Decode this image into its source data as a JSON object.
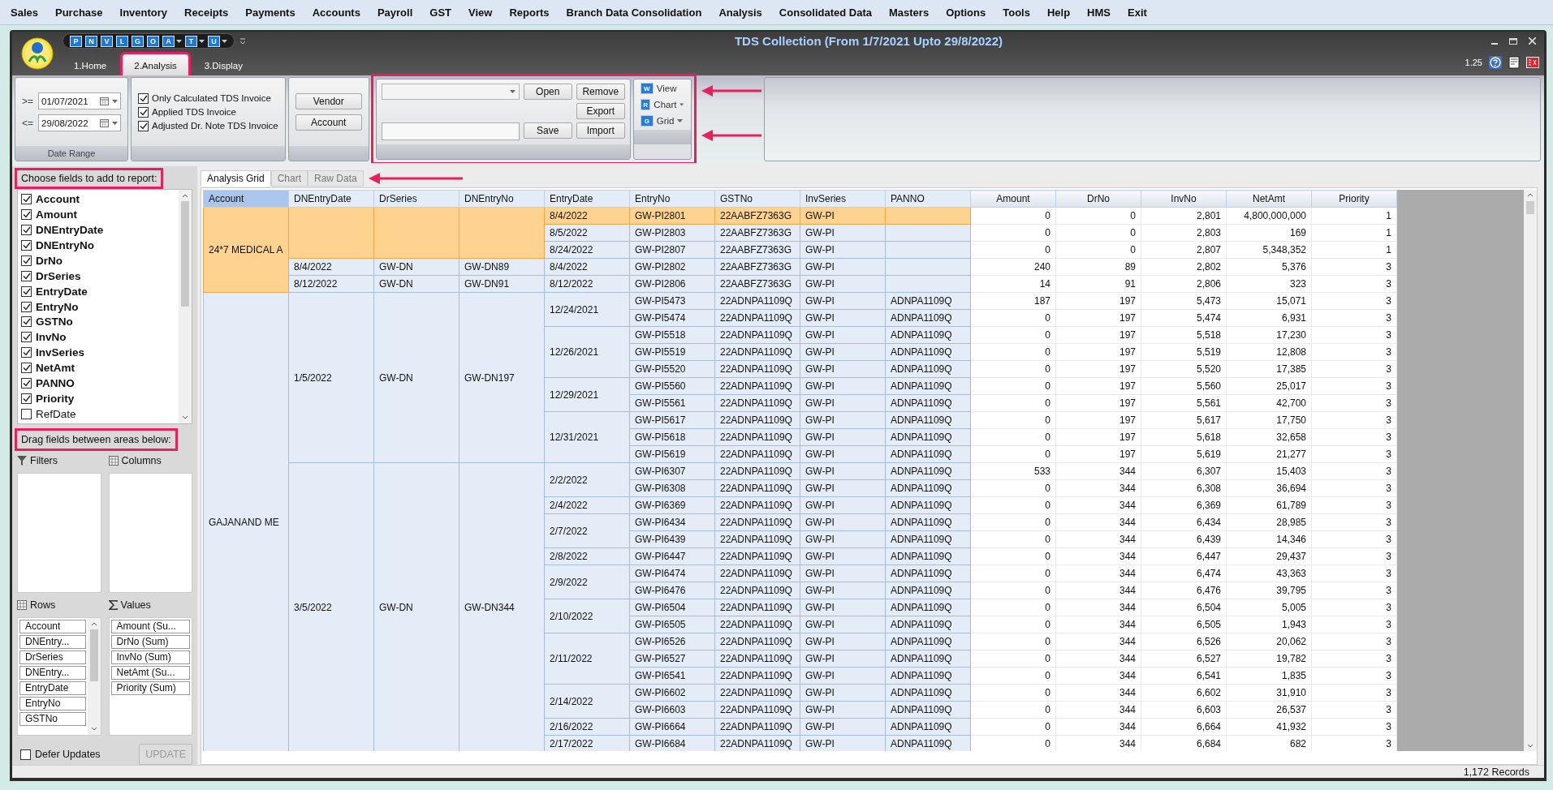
{
  "menu": [
    "Sales",
    "Purchase",
    "Inventory",
    "Receipts",
    "Payments",
    "Accounts",
    "Payroll",
    "GST",
    "View",
    "Reports",
    "Branch Data Consolidation",
    "Analysis",
    "Consolidated Data",
    "Masters",
    "Options",
    "Tools",
    "Help",
    "HMS",
    "Exit"
  ],
  "window": {
    "title": "TDS Collection (From 1/7/2021 Upto 29/8/2022)",
    "zoom": "1.25",
    "quick_access": [
      {
        "letter": "P",
        "dropdown": false
      },
      {
        "letter": "N",
        "dropdown": false
      },
      {
        "letter": "V",
        "dropdown": false
      },
      {
        "letter": "L",
        "dropdown": false
      },
      {
        "letter": "G",
        "dropdown": false
      },
      {
        "letter": "O",
        "dropdown": false
      },
      {
        "letter": "A",
        "dropdown": true
      },
      {
        "letter": "T",
        "dropdown": true
      },
      {
        "letter": "U",
        "dropdown": true
      }
    ]
  },
  "ribbon_tabs": [
    {
      "label": "1.Home",
      "selected": false,
      "annotated": false
    },
    {
      "label": "2.Analysis",
      "selected": true,
      "annotated": true
    },
    {
      "label": "3.Display",
      "selected": false,
      "annotated": false
    }
  ],
  "ribbon": {
    "date_range": {
      "caption": "Date Range",
      "from_label": ">=",
      "from": "01/07/2021",
      "to_label": "<=",
      "to": "29/08/2022"
    },
    "options": [
      {
        "label": "Only Calculated TDS Invoice",
        "checked": true
      },
      {
        "label": "Applied TDS Invoice",
        "checked": true
      },
      {
        "label": "Adjusted Dr. Note TDS Invoice",
        "checked": true
      }
    ],
    "party_buttons": [
      "Vendor",
      "Account"
    ],
    "layout": {
      "annotated": true,
      "rows": [
        {
          "kind": "combo",
          "buttons": [
            "Open",
            "Remove"
          ]
        },
        {
          "buttons": [
            "Export"
          ]
        },
        {
          "kind": "text",
          "buttons": [
            "Save",
            "Import"
          ]
        }
      ],
      "views": [
        {
          "label": "View",
          "letter": "W",
          "dropdown": false
        },
        {
          "label": "Chart",
          "letter": "R",
          "dropdown": true
        },
        {
          "label": "Grid",
          "letter": "G",
          "dropdown": true
        }
      ]
    }
  },
  "field_panel": {
    "choose_label": {
      "text": "Choose fields to add to report:",
      "annotated": true
    },
    "fields": [
      {
        "label": "Account",
        "checked": true
      },
      {
        "label": "Amount",
        "checked": true
      },
      {
        "label": "DNEntryDate",
        "checked": true
      },
      {
        "label": "DNEntryNo",
        "checked": true
      },
      {
        "label": "DrNo",
        "checked": true
      },
      {
        "label": "DrSeries",
        "checked": true
      },
      {
        "label": "EntryDate",
        "checked": true
      },
      {
        "label": "EntryNo",
        "checked": true
      },
      {
        "label": "GSTNo",
        "checked": true
      },
      {
        "label": "InvNo",
        "checked": true
      },
      {
        "label": "InvSeries",
        "checked": true
      },
      {
        "label": "NetAmt",
        "checked": true
      },
      {
        "label": "PANNO",
        "checked": true
      },
      {
        "label": "Priority",
        "checked": true
      },
      {
        "label": "RefDate",
        "checked": false
      }
    ],
    "drag_label": {
      "text": "Drag fields between areas below:",
      "annotated": true
    },
    "areas": [
      {
        "kind": "filters",
        "label": "Filters"
      },
      {
        "kind": "columns",
        "label": "Columns"
      },
      {
        "kind": "rows",
        "label": "Rows",
        "items": [
          "Account",
          "DNEntry...",
          "DrSeries",
          "DNEntry...",
          "EntryDate",
          "EntryNo",
          "GSTNo"
        ]
      },
      {
        "kind": "values",
        "label": "Values",
        "items": [
          "Amount (Su...",
          "DrNo (Sum)",
          "InvNo (Sum)",
          "NetAmt (Su...",
          "Priority (Sum)"
        ]
      }
    ],
    "defer_updates": {
      "label": "Defer Updates",
      "checked": false
    },
    "update_button": {
      "label": "UPDATE",
      "disabled": true
    }
  },
  "grid_tabs": [
    {
      "label": "Analysis Grid",
      "selected": true
    },
    {
      "label": "Chart",
      "selected": false
    },
    {
      "label": "Raw Data",
      "selected": false
    }
  ],
  "grid": {
    "columns": [
      {
        "label": "Account",
        "kind": "text",
        "selected": true
      },
      {
        "label": "DNEntryDate",
        "kind": "text",
        "selected": false
      },
      {
        "label": "DrSeries",
        "kind": "text",
        "selected": false
      },
      {
        "label": "DNEntryNo",
        "kind": "text",
        "selected": false
      },
      {
        "label": "EntryDate",
        "kind": "text",
        "selected": false
      },
      {
        "label": "EntryNo",
        "kind": "text",
        "selected": false
      },
      {
        "label": "GSTNo",
        "kind": "text",
        "selected": false
      },
      {
        "label": "InvSeries",
        "kind": "text",
        "selected": false
      },
      {
        "label": "PANNO",
        "kind": "text",
        "selected": false
      },
      {
        "label": "Amount",
        "kind": "number",
        "selected": false
      },
      {
        "label": "DrNo",
        "kind": "number",
        "selected": false
      },
      {
        "label": "InvNo",
        "kind": "number",
        "selected": false
      },
      {
        "label": "NetAmt",
        "kind": "number",
        "selected": false
      },
      {
        "label": "Priority",
        "kind": "number",
        "selected": false
      }
    ],
    "groups": [
      {
        "account": "24*7 MEDICAL A",
        "selected": true,
        "dn": [
          {
            "selected": true,
            "dates": [
              {
                "entry_date": "8/4/2022",
                "selected": true,
                "entries": [
                  {
                    "entry_no": "GW-PI2801",
                    "gst_no": "22AABFZ7363G",
                    "inv_series": "GW-PI",
                    "amount": "0",
                    "dr_no": "0",
                    "inv_no": "2,801",
                    "net_amt": "4,800,000,000",
                    "priority": "1",
                    "selected": true
                  }
                ]
              },
              {
                "entry_date": "8/5/2022",
                "selected": false,
                "entries": [
                  {
                    "entry_no": "GW-PI2803",
                    "gst_no": "22AABFZ7363G",
                    "inv_series": "GW-PI",
                    "amount": "0",
                    "dr_no": "0",
                    "inv_no": "2,803",
                    "net_amt": "169",
                    "priority": "1",
                    "selected": false
                  }
                ]
              },
              {
                "entry_date": "8/24/2022",
                "selected": false,
                "entries": [
                  {
                    "entry_no": "GW-PI2807",
                    "gst_no": "22AABFZ7363G",
                    "inv_series": "GW-PI",
                    "amount": "0",
                    "dr_no": "0",
                    "inv_no": "2,807",
                    "net_amt": "5,348,352",
                    "priority": "1",
                    "selected": false
                  }
                ]
              }
            ]
          },
          {
            "dn_entry_date": "8/4/2022",
            "dr_series": "GW-DN",
            "dn_entry_no": "GW-DN89",
            "selected": false,
            "dates": [
              {
                "entry_date": "8/4/2022",
                "selected": false,
                "entries": [
                  {
                    "entry_no": "GW-PI2802",
                    "gst_no": "22AABFZ7363G",
                    "inv_series": "GW-PI",
                    "amount": "240",
                    "dr_no": "89",
                    "inv_no": "2,802",
                    "net_amt": "5,376",
                    "priority": "3",
                    "selected": false
                  }
                ]
              }
            ]
          },
          {
            "dn_entry_date": "8/12/2022",
            "dr_series": "GW-DN",
            "dn_entry_no": "GW-DN91",
            "selected": false,
            "dates": [
              {
                "entry_date": "8/12/2022",
                "selected": false,
                "entries": [
                  {
                    "entry_no": "GW-PI2806",
                    "gst_no": "22AABFZ7363G",
                    "inv_series": "GW-PI",
                    "amount": "14",
                    "dr_no": "91",
                    "inv_no": "2,806",
                    "net_amt": "323",
                    "priority": "3",
                    "selected": false
                  }
                ]
              }
            ]
          }
        ]
      },
      {
        "account": "GAJANAND ME",
        "selected": false,
        "dn": [
          {
            "dn_entry_date": "1/5/2022",
            "dr_series": "GW-DN",
            "dn_entry_no": "GW-DN197",
            "selected": false,
            "dates": [
              {
                "entry_date": "12/24/2021",
                "selected": false,
                "entries": [
                  {
                    "entry_no": "GW-PI5473",
                    "gst_no": "22ADNPA1109Q",
                    "inv_series": "GW-PI",
                    "pan_no": "ADNPA1109Q",
                    "amount": "187",
                    "dr_no": "197",
                    "inv_no": "5,473",
                    "net_amt": "15,071",
                    "priority": "3",
                    "selected": false
                  },
                  {
                    "entry_no": "GW-PI5474",
                    "gst_no": "22ADNPA1109Q",
                    "inv_series": "GW-PI",
                    "pan_no": "ADNPA1109Q",
                    "amount": "0",
                    "dr_no": "197",
                    "inv_no": "5,474",
                    "net_amt": "6,931",
                    "priority": "3",
                    "selected": false
                  }
                ]
              },
              {
                "entry_date": "12/26/2021",
                "selected": false,
                "entries": [
                  {
                    "entry_no": "GW-PI5518",
                    "gst_no": "22ADNPA1109Q",
                    "inv_series": "GW-PI",
                    "pan_no": "ADNPA1109Q",
                    "amount": "0",
                    "dr_no": "197",
                    "inv_no": "5,518",
                    "net_amt": "17,230",
                    "priority": "3",
                    "selected": false
                  },
                  {
                    "entry_no": "GW-PI5519",
                    "gst_no": "22ADNPA1109Q",
                    "inv_series": "GW-PI",
                    "pan_no": "ADNPA1109Q",
                    "amount": "0",
                    "dr_no": "197",
                    "inv_no": "5,519",
                    "net_amt": "12,808",
                    "priority": "3",
                    "selected": false
                  },
                  {
                    "entry_no": "GW-PI5520",
                    "gst_no": "22ADNPA1109Q",
                    "inv_series": "GW-PI",
                    "pan_no": "ADNPA1109Q",
                    "amount": "0",
                    "dr_no": "197",
                    "inv_no": "5,520",
                    "net_amt": "17,385",
                    "priority": "3",
                    "selected": false
                  }
                ]
              },
              {
                "entry_date": "12/29/2021",
                "selected": false,
                "entries": [
                  {
                    "entry_no": "GW-PI5560",
                    "gst_no": "22ADNPA1109Q",
                    "inv_series": "GW-PI",
                    "pan_no": "ADNPA1109Q",
                    "amount": "0",
                    "dr_no": "197",
                    "inv_no": "5,560",
                    "net_amt": "25,017",
                    "priority": "3",
                    "selected": false
                  },
                  {
                    "entry_no": "GW-PI5561",
                    "gst_no": "22ADNPA1109Q",
                    "inv_series": "GW-PI",
                    "pan_no": "ADNPA1109Q",
                    "amount": "0",
                    "dr_no": "197",
                    "inv_no": "5,561",
                    "net_amt": "42,700",
                    "priority": "3",
                    "selected": false
                  }
                ]
              },
              {
                "entry_date": "12/31/2021",
                "selected": false,
                "entries": [
                  {
                    "entry_no": "GW-PI5617",
                    "gst_no": "22ADNPA1109Q",
                    "inv_series": "GW-PI",
                    "pan_no": "ADNPA1109Q",
                    "amount": "0",
                    "dr_no": "197",
                    "inv_no": "5,617",
                    "net_amt": "17,750",
                    "priority": "3",
                    "selected": false
                  },
                  {
                    "entry_no": "GW-PI5618",
                    "gst_no": "22ADNPA1109Q",
                    "inv_series": "GW-PI",
                    "pan_no": "ADNPA1109Q",
                    "amount": "0",
                    "dr_no": "197",
                    "inv_no": "5,618",
                    "net_amt": "32,658",
                    "priority": "3",
                    "selected": false
                  },
                  {
                    "entry_no": "GW-PI5619",
                    "gst_no": "22ADNPA1109Q",
                    "inv_series": "GW-PI",
                    "pan_no": "ADNPA1109Q",
                    "amount": "0",
                    "dr_no": "197",
                    "inv_no": "5,619",
                    "net_amt": "21,277",
                    "priority": "3",
                    "selected": false
                  }
                ]
              }
            ]
          },
          {
            "dn_entry_date": "3/5/2022",
            "dr_series": "GW-DN",
            "dn_entry_no": "GW-DN344",
            "selected": false,
            "dates": [
              {
                "entry_date": "2/2/2022",
                "selected": false,
                "entries": [
                  {
                    "entry_no": "GW-PI6307",
                    "gst_no": "22ADNPA1109Q",
                    "inv_series": "GW-PI",
                    "pan_no": "ADNPA1109Q",
                    "amount": "533",
                    "dr_no": "344",
                    "inv_no": "6,307",
                    "net_amt": "15,403",
                    "priority": "3",
                    "selected": false
                  },
                  {
                    "entry_no": "GW-PI6308",
                    "gst_no": "22ADNPA1109Q",
                    "inv_series": "GW-PI",
                    "pan_no": "ADNPA1109Q",
                    "amount": "0",
                    "dr_no": "344",
                    "inv_no": "6,308",
                    "net_amt": "36,694",
                    "priority": "3",
                    "selected": false
                  }
                ]
              },
              {
                "entry_date": "2/4/2022",
                "selected": false,
                "entries": [
                  {
                    "entry_no": "GW-PI6369",
                    "gst_no": "22ADNPA1109Q",
                    "inv_series": "GW-PI",
                    "pan_no": "ADNPA1109Q",
                    "amount": "0",
                    "dr_no": "344",
                    "inv_no": "6,369",
                    "net_amt": "61,789",
                    "priority": "3",
                    "selected": false
                  }
                ]
              },
              {
                "entry_date": "2/7/2022",
                "selected": false,
                "entries": [
                  {
                    "entry_no": "GW-PI6434",
                    "gst_no": "22ADNPA1109Q",
                    "inv_series": "GW-PI",
                    "pan_no": "ADNPA1109Q",
                    "amount": "0",
                    "dr_no": "344",
                    "inv_no": "6,434",
                    "net_amt": "28,985",
                    "priority": "3",
                    "selected": false
                  },
                  {
                    "entry_no": "GW-PI6439",
                    "gst_no": "22ADNPA1109Q",
                    "inv_series": "GW-PI",
                    "pan_no": "ADNPA1109Q",
                    "amount": "0",
                    "dr_no": "344",
                    "inv_no": "6,439",
                    "net_amt": "14,346",
                    "priority": "3",
                    "selected": false
                  }
                ]
              },
              {
                "entry_date": "2/8/2022",
                "selected": false,
                "entries": [
                  {
                    "entry_no": "GW-PI6447",
                    "gst_no": "22ADNPA1109Q",
                    "inv_series": "GW-PI",
                    "pan_no": "ADNPA1109Q",
                    "amount": "0",
                    "dr_no": "344",
                    "inv_no": "6,447",
                    "net_amt": "29,437",
                    "priority": "3",
                    "selected": false
                  }
                ]
              },
              {
                "entry_date": "2/9/2022",
                "selected": false,
                "entries": [
                  {
                    "entry_no": "GW-PI6474",
                    "gst_no": "22ADNPA1109Q",
                    "inv_series": "GW-PI",
                    "pan_no": "ADNPA1109Q",
                    "amount": "0",
                    "dr_no": "344",
                    "inv_no": "6,474",
                    "net_amt": "43,363",
                    "priority": "3",
                    "selected": false
                  },
                  {
                    "entry_no": "GW-PI6476",
                    "gst_no": "22ADNPA1109Q",
                    "inv_series": "GW-PI",
                    "pan_no": "ADNPA1109Q",
                    "amount": "0",
                    "dr_no": "344",
                    "inv_no": "6,476",
                    "net_amt": "39,795",
                    "priority": "3",
                    "selected": false
                  }
                ]
              },
              {
                "entry_date": "2/10/2022",
                "selected": false,
                "entries": [
                  {
                    "entry_no": "GW-PI6504",
                    "gst_no": "22ADNPA1109Q",
                    "inv_series": "GW-PI",
                    "pan_no": "ADNPA1109Q",
                    "amount": "0",
                    "dr_no": "344",
                    "inv_no": "6,504",
                    "net_amt": "5,005",
                    "priority": "3",
                    "selected": false
                  },
                  {
                    "entry_no": "GW-PI6505",
                    "gst_no": "22ADNPA1109Q",
                    "inv_series": "GW-PI",
                    "pan_no": "ADNPA1109Q",
                    "amount": "0",
                    "dr_no": "344",
                    "inv_no": "6,505",
                    "net_amt": "1,943",
                    "priority": "3",
                    "selected": false
                  }
                ]
              },
              {
                "entry_date": "2/11/2022",
                "selected": false,
                "entries": [
                  {
                    "entry_no": "GW-PI6526",
                    "gst_no": "22ADNPA1109Q",
                    "inv_series": "GW-PI",
                    "pan_no": "ADNPA1109Q",
                    "amount": "0",
                    "dr_no": "344",
                    "inv_no": "6,526",
                    "net_amt": "20,062",
                    "priority": "3",
                    "selected": false
                  },
                  {
                    "entry_no": "GW-PI6527",
                    "gst_no": "22ADNPA1109Q",
                    "inv_series": "GW-PI",
                    "pan_no": "ADNPA1109Q",
                    "amount": "0",
                    "dr_no": "344",
                    "inv_no": "6,527",
                    "net_amt": "19,782",
                    "priority": "3",
                    "selected": false
                  },
                  {
                    "entry_no": "GW-PI6541",
                    "gst_no": "22ADNPA1109Q",
                    "inv_series": "GW-PI",
                    "pan_no": "ADNPA1109Q",
                    "amount": "0",
                    "dr_no": "344",
                    "inv_no": "6,541",
                    "net_amt": "1,835",
                    "priority": "3",
                    "selected": false
                  }
                ]
              },
              {
                "entry_date": "2/14/2022",
                "selected": false,
                "entries": [
                  {
                    "entry_no": "GW-PI6602",
                    "gst_no": "22ADNPA1109Q",
                    "inv_series": "GW-PI",
                    "pan_no": "ADNPA1109Q",
                    "amount": "0",
                    "dr_no": "344",
                    "inv_no": "6,602",
                    "net_amt": "31,910",
                    "priority": "3",
                    "selected": false
                  },
                  {
                    "entry_no": "GW-PI6603",
                    "gst_no": "22ADNPA1109Q",
                    "inv_series": "GW-PI",
                    "pan_no": "ADNPA1109Q",
                    "amount": "0",
                    "dr_no": "344",
                    "inv_no": "6,603",
                    "net_amt": "26,537",
                    "priority": "3",
                    "selected": false
                  }
                ]
              },
              {
                "entry_date": "2/16/2022",
                "selected": false,
                "entries": [
                  {
                    "entry_no": "GW-PI6664",
                    "gst_no": "22ADNPA1109Q",
                    "inv_series": "GW-PI",
                    "pan_no": "ADNPA1109Q",
                    "amount": "0",
                    "dr_no": "344",
                    "inv_no": "6,664",
                    "net_amt": "41,932",
                    "priority": "3",
                    "selected": false
                  }
                ]
              },
              {
                "entry_date": "2/17/2022",
                "selected": false,
                "entries": [
                  {
                    "entry_no": "GW-PI6684",
                    "gst_no": "22ADNPA1109Q",
                    "inv_series": "GW-PI",
                    "pan_no": "ADNPA1109Q",
                    "amount": "0",
                    "dr_no": "344",
                    "inv_no": "6,684",
                    "net_amt": "682",
                    "priority": "3",
                    "selected": false
                  }
                ]
              }
            ]
          }
        ]
      }
    ]
  },
  "status_bar": {
    "records": "1,172 Records"
  }
}
